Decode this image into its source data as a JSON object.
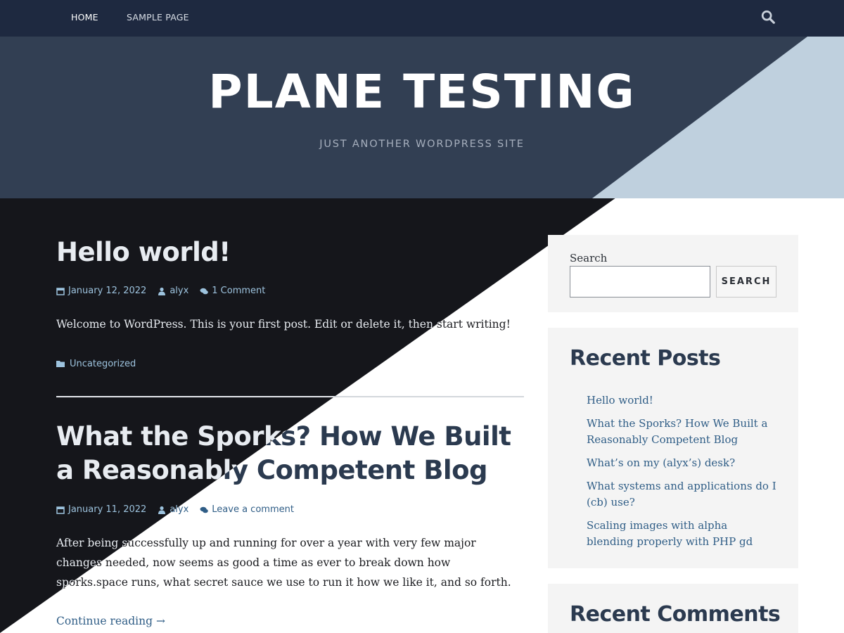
{
  "nav": {
    "items": [
      {
        "label": "HOME"
      },
      {
        "label": "SAMPLE PAGE"
      }
    ],
    "search_icon": "search-icon"
  },
  "header": {
    "title": "PLANE TESTING",
    "description": "JUST ANOTHER WORDPRESS SITE"
  },
  "colors": {
    "navbar": "#1e2940",
    "header_dark": "#323f53",
    "header_light": "#bfd0de",
    "content_dark": "#15161b",
    "link": "#2f5d86",
    "heading": "#2b3a4f"
  },
  "posts": [
    {
      "title": "Hello world!",
      "date": "January 12, 2022",
      "author": "alyx",
      "comments": "1 Comment",
      "body": "Welcome to WordPress. This is your first post. Edit or delete it, then start writing!",
      "category": "Uncategorized"
    },
    {
      "title": "What the Sporks? How We Built a Reasonably Competent Blog",
      "date": "January 11, 2022",
      "author": "alyx",
      "comments": "Leave a comment",
      "body": "After being successfully up and running for over a year with very few major changes needed, now seems as good a time as ever to break down how sporks.space runs, what secret sauce we use to run it how we like it, and so forth.",
      "more": "Continue reading →"
    }
  ],
  "sidebar": {
    "search": {
      "label": "Search",
      "value": "",
      "button": "SEARCH"
    },
    "recent_posts": {
      "title": "Recent Posts",
      "items": [
        "Hello world!",
        "What the Sporks? How We Built a Reasonably Competent Blog",
        "What’s on my (alyx’s) desk?",
        "What systems and applications do I (cb) use?",
        "Scaling images with alpha blending properly with PHP gd"
      ]
    },
    "recent_comments": {
      "title": "Recent Comments"
    }
  }
}
